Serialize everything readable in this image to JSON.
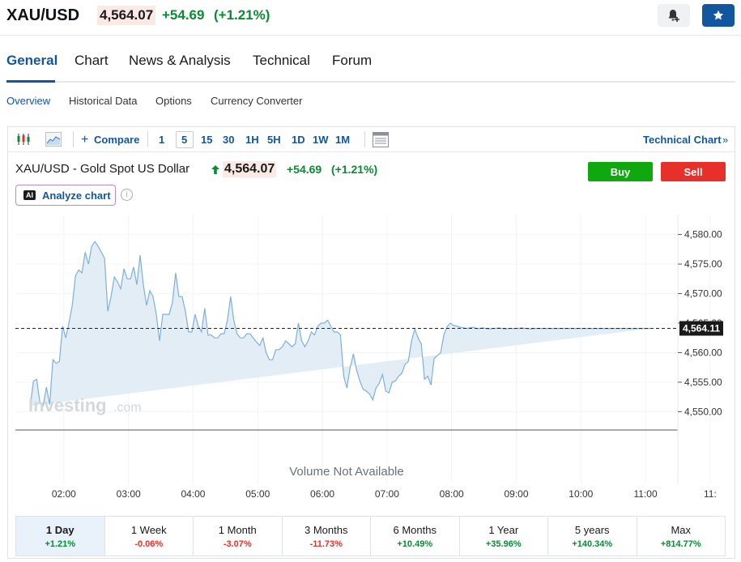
{
  "header": {
    "symbol": "XAU/USD",
    "price": "4,564.07",
    "change": "+54.69",
    "change_pct": "(+1.21%)"
  },
  "tabs": [
    "General",
    "Chart",
    "News & Analysis",
    "Technical",
    "Forum"
  ],
  "subtabs": [
    "Overview",
    "Historical Data",
    "Options",
    "Currency Converter"
  ],
  "toolbar": {
    "compare": "Compare",
    "intervals": [
      "1",
      "5",
      "15",
      "30",
      "1H",
      "5H",
      "1D",
      "1W",
      "1M"
    ],
    "technical_chart": "Technical Chart"
  },
  "chart_header": {
    "title": "XAU/USD - Gold Spot US Dollar",
    "price": "4,564.07",
    "change": "+54.69",
    "change_pct": "(+1.21%)",
    "buy": "Buy",
    "sell": "Sell",
    "analyze": "Analyze chart",
    "ai_badge": "AI"
  },
  "watermark": {
    "brand": "Investing",
    "suffix": ".com"
  },
  "volume_note": "Volume Not Available",
  "colors": {
    "accent": "#1256a0",
    "up": "#0a8a34",
    "down": "#e8302a",
    "line": "#7fb0d8",
    "fill": "#e3edf6"
  },
  "chart_data": {
    "type": "area",
    "x_ticks": [
      "02:00",
      "03:00",
      "04:00",
      "05:00",
      "06:00",
      "07:00",
      "08:00",
      "09:00",
      "10:00",
      "11:00",
      "11:"
    ],
    "y_ticks": [
      "4,580.00",
      "4,575.00",
      "4,570.00",
      "4,565.00",
      "4,560.00",
      "4,555.00",
      "4,550.00"
    ],
    "ylim": [
      4548,
      4582
    ],
    "last_price_label": "4,564.11",
    "last_price": 4564.11,
    "x": [
      1.48,
      1.53,
      1.58,
      1.63,
      1.68,
      1.73,
      1.78,
      1.83,
      1.88,
      1.93,
      1.98,
      2.03,
      2.08,
      2.13,
      2.18,
      2.23,
      2.28,
      2.33,
      2.38,
      2.43,
      2.48,
      2.53,
      2.58,
      2.63,
      2.68,
      2.73,
      2.78,
      2.83,
      2.88,
      2.93,
      2.98,
      3.03,
      3.08,
      3.13,
      3.18,
      3.23,
      3.28,
      3.33,
      3.38,
      3.43,
      3.48,
      3.53,
      3.58,
      3.63,
      3.68,
      3.73,
      3.78,
      3.83,
      3.88,
      3.93,
      3.98,
      4.03,
      4.08,
      4.13,
      4.18,
      4.23,
      4.28,
      4.33,
      4.38,
      4.43,
      4.48,
      4.53,
      4.58,
      4.63,
      4.68,
      4.73,
      4.78,
      4.83,
      4.88,
      4.93,
      4.98,
      5.03,
      5.08,
      5.13,
      5.18,
      5.23,
      5.28,
      5.33,
      5.38,
      5.43,
      5.48,
      5.53,
      5.58,
      5.63,
      5.68,
      5.73,
      5.78,
      5.83,
      5.88,
      5.93,
      5.98,
      6.03,
      6.08,
      6.13,
      6.18,
      6.23,
      6.28,
      6.33,
      6.38,
      6.43,
      6.48,
      6.53,
      6.58,
      6.63,
      6.68,
      6.73,
      6.78,
      6.83,
      6.88,
      6.93,
      6.98,
      7.03,
      7.08,
      7.13,
      7.18,
      7.23,
      7.28,
      7.33,
      7.38,
      7.43,
      7.48,
      7.53,
      7.58,
      7.63,
      7.68,
      7.73,
      7.78,
      7.83,
      7.88,
      7.93,
      7.98,
      8.03,
      8.08,
      8.13,
      8.18,
      8.23,
      8.28,
      8.33,
      8.38,
      8.43,
      8.48,
      8.53,
      8.58,
      8.63,
      8.68,
      8.73,
      8.78,
      8.83,
      8.88,
      8.93,
      8.98,
      9.03,
      9.08,
      9.13,
      9.18,
      9.23,
      9.28,
      9.33,
      9.38,
      9.43,
      9.48,
      9.53,
      9.58,
      9.63,
      9.68,
      9.73,
      9.78,
      9.83,
      9.88,
      9.93,
      9.98,
      10.03,
      10.08,
      10.13,
      10.18,
      10.23,
      10.28,
      10.33,
      10.38,
      10.43,
      10.48,
      10.53,
      10.58,
      10.63,
      10.68,
      10.73,
      10.78,
      10.83,
      10.88,
      10.93,
      10.98,
      11.03,
      11.08,
      11.13,
      11.18,
      11.23,
      11.28,
      11.33,
      11.38
    ],
    "values": [
      4551.0,
      4555.2,
      4555.5,
      4551.5,
      4551.0,
      4554.2,
      4551.2,
      4558.8,
      4558.2,
      4558.5,
      4564.5,
      4562.5,
      4565.0,
      4568.0,
      4573.0,
      4574.0,
      4573.5,
      4577.0,
      4575.0,
      4578.0,
      4578.8,
      4578.0,
      4577.0,
      4576.0,
      4567.0,
      4569.5,
      4572.8,
      4572.0,
      4570.8,
      4574.2,
      4572.5,
      4572.5,
      4574.5,
      4571.5,
      4576.5,
      4571.5,
      4568.0,
      4570.5,
      4569.5,
      4566.5,
      4562.0,
      4566.5,
      4566.5,
      4566.5,
      4568.5,
      4573.5,
      4569.5,
      4569.5,
      4567.0,
      4563.5,
      4563.5,
      4566.5,
      4564.5,
      4563.5,
      4567.5,
      4563.0,
      4563.0,
      4562.5,
      4562.5,
      4563.2,
      4563.2,
      4565.5,
      4569.5,
      4565.5,
      4563.2,
      4562.5,
      4562.5,
      4563.2,
      4563.2,
      4562.5,
      4561.8,
      4561.2,
      4562.5,
      4560.0,
      4558.8,
      4558.8,
      4560.5,
      4560.5,
      4561.0,
      4562.0,
      4561.5,
      4561.0,
      4561.5,
      4565.0,
      4562.0,
      4561.0,
      4562.0,
      4563.5,
      4563.0,
      4564.5,
      4565.0,
      4565.0,
      4565.5,
      4564.5,
      4563.5,
      4563.5,
      4563.0,
      4556.0,
      4554.0,
      4557.5,
      4559.8,
      4557.0,
      4555.2,
      4553.8,
      4553.5,
      4553.0,
      4552.0,
      4554.0,
      4554.8,
      4556.3,
      4553.5,
      4553.2,
      4555.0,
      4555.2,
      4556.0,
      4556.5,
      4558.0,
      4558.5,
      4562.0,
      4564.0,
      4562.5,
      4561.5,
      4555.5,
      4556.0,
      4554.5,
      4559.0,
      4559.5,
      4560.0,
      4563.0,
      4564.4,
      4565.0,
      4564.6,
      4564.5,
      4564.3,
      4564.2,
      4564.1,
      4564.2,
      4564.3,
      4564.1,
      4564.1,
      4564.2,
      4564.1,
      4564.0,
      4564.1,
      4564.1,
      4564.2,
      4564.1,
      4564.0,
      4564.1,
      4564.1,
      4564.1,
      4564.1,
      4564.2,
      4564.1,
      4564.1,
      4564.0,
      4564.1,
      4564.1,
      4564.1,
      4564.1,
      4564.1,
      4564.1,
      4564.1,
      4564.1,
      4564.1,
      4564.1,
      4564.1,
      4564.1,
      4564.1,
      4564.1,
      4564.1,
      4564.1,
      4564.1,
      4564.1,
      4564.1,
      4564.1,
      4564.1,
      4564.1,
      4564.1,
      4564.1,
      4564.1,
      4564.1,
      4564.1,
      4564.1,
      4564.1,
      4564.1,
      4564.1,
      4564.1,
      4564.1,
      4564.1,
      4564.1,
      4564.1,
      4564.1
    ]
  },
  "ranges": [
    {
      "label": "1 Day",
      "value": "+1.21%",
      "dir": "up"
    },
    {
      "label": "1 Week",
      "value": "-0.06%",
      "dir": "down"
    },
    {
      "label": "1 Month",
      "value": "-3.07%",
      "dir": "down"
    },
    {
      "label": "3 Months",
      "value": "-11.73%",
      "dir": "down"
    },
    {
      "label": "6 Months",
      "value": "+10.49%",
      "dir": "up"
    },
    {
      "label": "1 Year",
      "value": "+35.96%",
      "dir": "up"
    },
    {
      "label": "5 years",
      "value": "+140.34%",
      "dir": "up"
    },
    {
      "label": "Max",
      "value": "+814.77%",
      "dir": "up"
    }
  ]
}
